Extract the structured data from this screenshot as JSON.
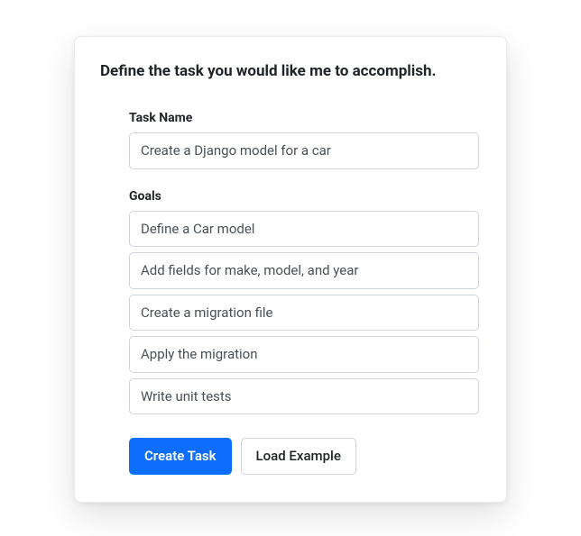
{
  "title": "Define the task you would like me to accomplish.",
  "task_name": {
    "label": "Task Name",
    "value": "Create a Django model for a car"
  },
  "goals": {
    "label": "Goals",
    "items": [
      "Define a Car model",
      "Add fields for make, model, and year",
      "Create a migration file",
      "Apply the migration",
      "Write unit tests"
    ]
  },
  "buttons": {
    "create": "Create Task",
    "load_example": "Load Example"
  }
}
